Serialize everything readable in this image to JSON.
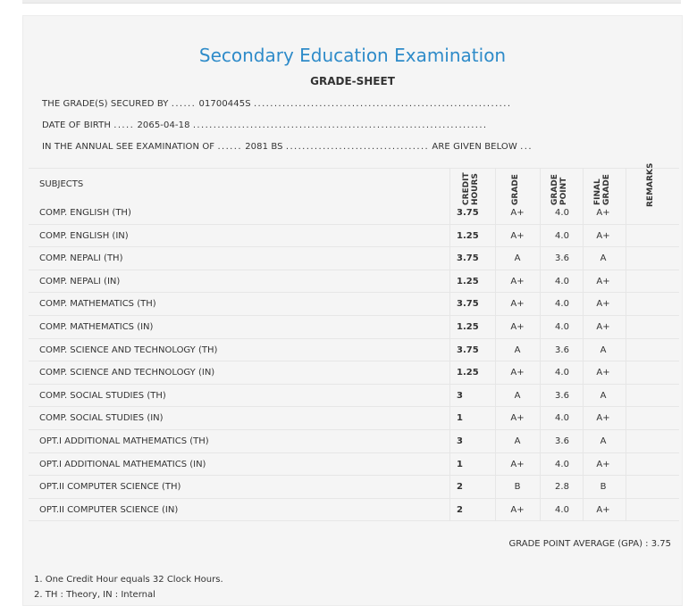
{
  "header": {
    "title": "Secondary Education Examination",
    "subtitle": "GRADE-SHEET"
  },
  "info": {
    "line1_label": "THE GRADE(S) SECURED BY",
    "symbol_no": "01700445S",
    "line2_label": "DATE OF BIRTH",
    "dob": "2065-04-18",
    "line3_label": "IN THE ANNUAL SEE EXAMINATION OF",
    "year": "2081 BS",
    "line3_suffix": "ARE GIVEN BELOW"
  },
  "table": {
    "headers": {
      "subjects": "SUBJECTS",
      "credit_hours": "CREDIT HOURS",
      "grade": "GRADE",
      "grade_point": "GRADE POINT",
      "final_grade": "FINAL GRADE",
      "remarks": "REMARKS"
    },
    "rows": [
      {
        "subject": "COMP. ENGLISH (TH)",
        "credit": "3.75",
        "grade": "A+",
        "point": "4.0",
        "final": "A+"
      },
      {
        "subject": "COMP. ENGLISH (IN)",
        "credit": "1.25",
        "grade": "A+",
        "point": "4.0",
        "final": "A+"
      },
      {
        "subject": "COMP. NEPALI (TH)",
        "credit": "3.75",
        "grade": "A",
        "point": "3.6",
        "final": "A"
      },
      {
        "subject": "COMP. NEPALI (IN)",
        "credit": "1.25",
        "grade": "A+",
        "point": "4.0",
        "final": "A+"
      },
      {
        "subject": "COMP. MATHEMATICS (TH)",
        "credit": "3.75",
        "grade": "A+",
        "point": "4.0",
        "final": "A+"
      },
      {
        "subject": "COMP. MATHEMATICS (IN)",
        "credit": "1.25",
        "grade": "A+",
        "point": "4.0",
        "final": "A+"
      },
      {
        "subject": "COMP. SCIENCE AND TECHNOLOGY (TH)",
        "credit": "3.75",
        "grade": "A",
        "point": "3.6",
        "final": "A"
      },
      {
        "subject": "COMP. SCIENCE AND TECHNOLOGY (IN)",
        "credit": "1.25",
        "grade": "A+",
        "point": "4.0",
        "final": "A+"
      },
      {
        "subject": "COMP. SOCIAL STUDIES (TH)",
        "credit": "3",
        "grade": "A",
        "point": "3.6",
        "final": "A"
      },
      {
        "subject": "COMP. SOCIAL STUDIES (IN)",
        "credit": "1",
        "grade": "A+",
        "point": "4.0",
        "final": "A+"
      },
      {
        "subject": "OPT.I ADDITIONAL MATHEMATICS (TH)",
        "credit": "3",
        "grade": "A",
        "point": "3.6",
        "final": "A"
      },
      {
        "subject": "OPT.I ADDITIONAL MATHEMATICS (IN)",
        "credit": "1",
        "grade": "A+",
        "point": "4.0",
        "final": "A+"
      },
      {
        "subject": "OPT.II COMPUTER SCIENCE (TH)",
        "credit": "2",
        "grade": "B",
        "point": "2.8",
        "final": "B"
      },
      {
        "subject": "OPT.II COMPUTER SCIENCE (IN)",
        "credit": "2",
        "grade": "A+",
        "point": "4.0",
        "final": "A+"
      }
    ]
  },
  "gpa": "GRADE POINT AVERAGE (GPA) : 3.75",
  "notes": [
    "1. One Credit Hour equals 32 Clock Hours.",
    "2. TH : Theory, IN : Internal"
  ]
}
